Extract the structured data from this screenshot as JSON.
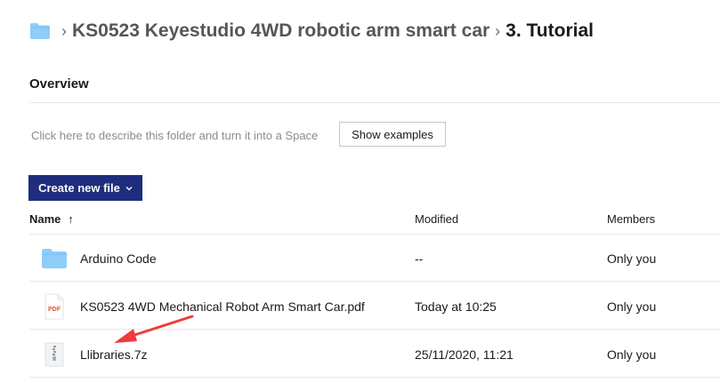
{
  "breadcrumb": {
    "separator": "›",
    "items": [
      {
        "label": "KS0523 Keyestudio 4WD robotic arm smart car"
      },
      {
        "label": "3. Tutorial"
      }
    ]
  },
  "overview": {
    "title": "Overview"
  },
  "description": {
    "placeholder": "Click here to describe this folder and turn it into a Space",
    "show_examples_label": "Show examples"
  },
  "create_button": {
    "label": "Create new file"
  },
  "table": {
    "columns": {
      "name": "Name",
      "sort_arrow": "↑",
      "modified": "Modified",
      "members": "Members"
    },
    "rows": [
      {
        "icon": "folder-icon",
        "name": "Arduino Code",
        "modified": "--",
        "members": "Only you"
      },
      {
        "icon": "pdf-file-icon",
        "icon_text": "PDF",
        "name": "KS0523 4WD Mechanical Robot Arm Smart Car.pdf",
        "modified": "Today at 10:25",
        "members": "Only you"
      },
      {
        "icon": "zip-file-icon",
        "name": "Llibraries.7z",
        "modified": "25/11/2020, 11:21",
        "members": "Only you"
      }
    ]
  },
  "colors": {
    "folder": "#8fcdf9",
    "primary_button": "#1e2d7d",
    "annotation_arrow": "#f03a3a"
  }
}
